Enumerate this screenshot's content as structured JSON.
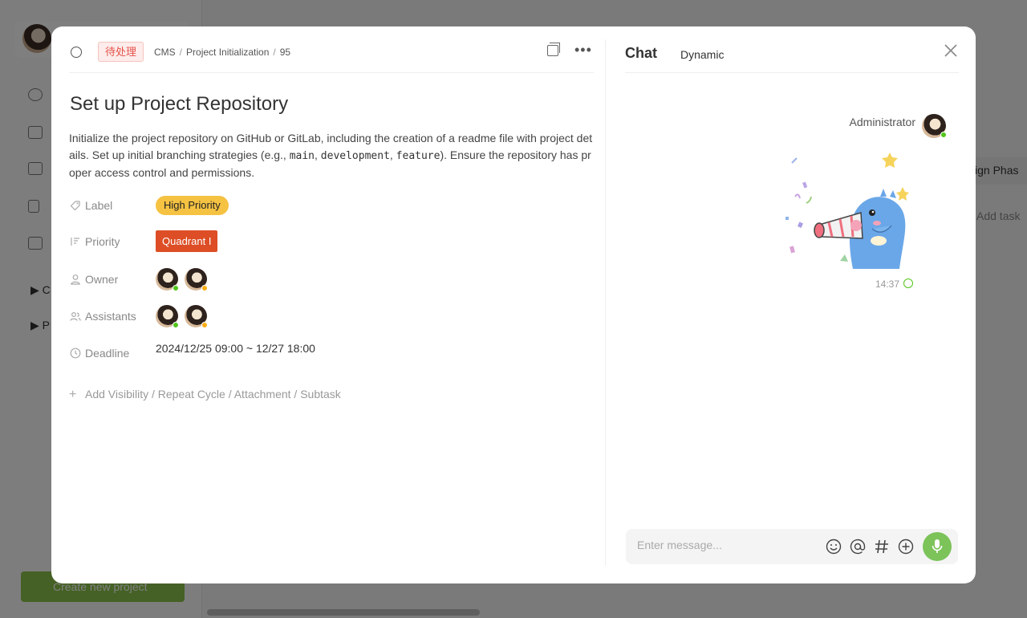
{
  "background": {
    "sidebar_tree": [
      "C",
      "P"
    ],
    "create_button": "Create new project",
    "right_text_1": "sign Phas",
    "right_text_2": "Add task"
  },
  "task": {
    "status": "待处理",
    "breadcrumb": [
      "CMS",
      "Project Initialization",
      "95"
    ],
    "title": "Set up Project Repository",
    "description_parts": {
      "p1": "Initialize the project repository on GitHub or GitLab, including the creation of a readme file with project details. Set up initial branching strategies (e.g., ",
      "c1": "main",
      "p2": ", ",
      "c2": "development",
      "p3": ", ",
      "c3": "feature",
      "p4": "). Ensure the repository has proper access control and permissions."
    },
    "fields": {
      "label": {
        "name": "Label",
        "value": "High Priority",
        "color": "#f5c242"
      },
      "priority": {
        "name": "Priority",
        "value": "Quadrant I",
        "color": "#dd4e26"
      },
      "owner": {
        "name": "Owner",
        "status_colors": [
          "#52c41a",
          "#faad14"
        ]
      },
      "assistants": {
        "name": "Assistants",
        "status_colors": [
          "#52c41a",
          "#faad14"
        ]
      },
      "deadline": {
        "name": "Deadline",
        "value": "2024/12/25 09:00 ~ 12/27 18:00"
      }
    },
    "add_more": "Add Visibility / Repeat Cycle / Attachment / Subtask"
  },
  "chat": {
    "tabs": {
      "chat": "Chat",
      "dynamic": "Dynamic"
    },
    "message": {
      "sender": "Administrator",
      "time": "14:37",
      "content_type": "sticker"
    },
    "composer": {
      "placeholder": "Enter message...",
      "value": ""
    },
    "accent": "#7cc35a"
  }
}
